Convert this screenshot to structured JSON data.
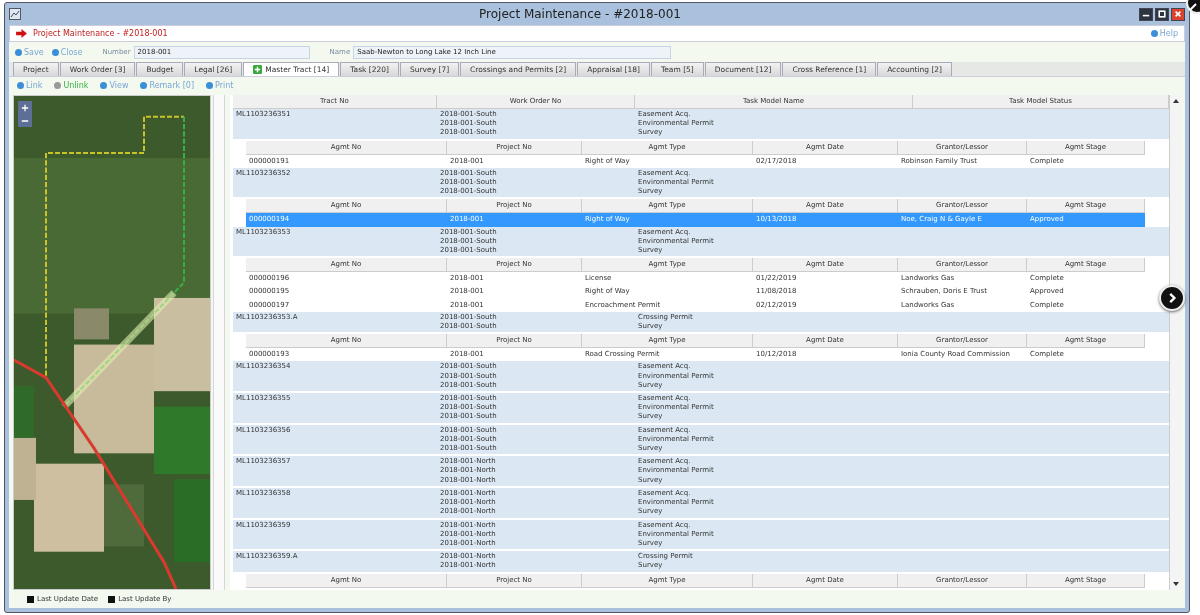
{
  "window": {
    "title": "Project Maintenance - #2018-001"
  },
  "header": {
    "title": "Project Maintenance - #2018-001",
    "help": "Help"
  },
  "toolbar": {
    "buttons": [
      "Save",
      "Close"
    ],
    "fields": [
      {
        "label": "Number",
        "value": "2018-001",
        "kind": "short"
      },
      {
        "label": "Name",
        "value": "Saab-Newton to Long Lake 12 Inch Line",
        "kind": "long"
      }
    ]
  },
  "tabs": [
    {
      "label": "Project",
      "selected": false
    },
    {
      "label": "Work Order [3]",
      "selected": false
    },
    {
      "label": "Budget",
      "selected": false
    },
    {
      "label": "Legal [26]",
      "selected": false
    },
    {
      "label": "Master Tract [14]",
      "selected": true
    },
    {
      "label": "Task [220]",
      "selected": false
    },
    {
      "label": "Survey [7]",
      "selected": false
    },
    {
      "label": "Crossings and Permits [2]",
      "selected": false
    },
    {
      "label": "Appraisal [18]",
      "selected": false
    },
    {
      "label": "Team [5]",
      "selected": false
    },
    {
      "label": "Document [12]",
      "selected": false
    },
    {
      "label": "Cross Reference [1]",
      "selected": false
    },
    {
      "label": "Accounting [2]",
      "selected": false
    }
  ],
  "actions": [
    {
      "label": "Link",
      "highlighted": false
    },
    {
      "label": "Unlink",
      "highlighted": true
    },
    {
      "label": "View",
      "highlighted": false
    },
    {
      "label": "Remark [0]",
      "highlighted": false
    },
    {
      "label": "Print",
      "highlighted": false
    }
  ],
  "table": {
    "columns": [
      "Tract No",
      "Work Order No",
      "Task Model Name",
      "Task Model Status"
    ],
    "tracts": [
      {
        "tract_no": "ML1103236351",
        "work_orders": [
          "2018-001-South",
          "2018-001-South",
          "2018-001-South"
        ],
        "task_models": [
          "Easement Acq.",
          "Environmental Permit",
          "Survey"
        ],
        "agreement_columns": [
          "Agmt No",
          "Project No",
          "Agmt Type",
          "Agmt Date",
          "Grantor/Lessor",
          "Agmt Stage"
        ],
        "agreements": [
          {
            "cells": [
              "000000191",
              "2018-001",
              "Right of Way",
              "02/17/2018",
              "Robinson Family Trust",
              "Complete"
            ],
            "selected": false
          }
        ]
      },
      {
        "tract_no": "ML1103236352",
        "work_orders": [
          "2018-001-South",
          "2018-001-South",
          "2018-001-South"
        ],
        "task_models": [
          "Easement Acq.",
          "Environmental Permit",
          "Survey"
        ],
        "agreement_columns": [
          "Agmt No",
          "Project No",
          "Agmt Type",
          "Agmt Date",
          "Grantor/Lessor",
          "Agmt Stage"
        ],
        "agreements": [
          {
            "cells": [
              "000000194",
              "2018-001",
              "Right of Way",
              "10/13/2018",
              "Noe, Craig N & Gayle E",
              "Approved"
            ],
            "selected": true
          }
        ]
      },
      {
        "tract_no": "ML1103236353",
        "work_orders": [
          "2018-001-South",
          "2018-001-South",
          "2018-001-South"
        ],
        "task_models": [
          "Easement Acq.",
          "Environmental Permit",
          "Survey"
        ],
        "agreement_columns": [
          "Agmt No",
          "Project No",
          "Agmt Type",
          "Agmt Date",
          "Grantor/Lessor",
          "Agmt Stage"
        ],
        "agreements": [
          {
            "cells": [
              "000000196",
              "2018-001",
              "License",
              "01/22/2019",
              "Landworks Gas",
              "Complete"
            ],
            "selected": false
          },
          {
            "cells": [
              "000000195",
              "2018-001",
              "Right of Way",
              "11/08/2018",
              "Schrauben, Doris E Trust",
              "Approved"
            ],
            "selected": false
          },
          {
            "cells": [
              "000000197",
              "2018-001",
              "Encroachment Permit",
              "02/12/2019",
              "Landworks Gas",
              "Complete"
            ],
            "selected": false
          }
        ]
      },
      {
        "tract_no": "ML1103236353.A",
        "work_orders": [
          "2018-001-South",
          "2018-001-South"
        ],
        "task_models": [
          "Crossing Permit",
          "Survey"
        ],
        "agreement_columns": [
          "Agmt No",
          "Project No",
          "Agmt Type",
          "Agmt Date",
          "Grantor/Lessor",
          "Agmt Stage"
        ],
        "agreements": [
          {
            "cells": [
              "000000193",
              "2018-001",
              "Road Crossing Permit",
              "10/12/2018",
              "Ionia County Road Commission",
              "Complete"
            ],
            "selected": false
          }
        ]
      },
      {
        "tract_no": "ML1103236354",
        "work_orders": [
          "2018-001-South",
          "2018-001-South",
          "2018-001-South"
        ],
        "task_models": [
          "Easement Acq.",
          "Environmental Permit",
          "Survey"
        ]
      },
      {
        "tract_no": "ML1103236355",
        "work_orders": [
          "2018-001-South",
          "2018-001-South",
          "2018-001-South"
        ],
        "task_models": [
          "Easement Acq.",
          "Environmental Permit",
          "Survey"
        ]
      },
      {
        "tract_no": "ML1103236356",
        "work_orders": [
          "2018-001-South",
          "2018-001-South",
          "2018-001-South"
        ],
        "task_models": [
          "Easement Acq.",
          "Environmental Permit",
          "Survey"
        ]
      },
      {
        "tract_no": "ML1103236357",
        "work_orders": [
          "2018-001-North",
          "2018-001-North",
          "2018-001-North"
        ],
        "task_models": [
          "Easement Acq.",
          "Environmental Permit",
          "Survey"
        ]
      },
      {
        "tract_no": "ML1103236358",
        "work_orders": [
          "2018-001-North",
          "2018-001-North",
          "2018-001-North"
        ],
        "task_models": [
          "Easement Acq.",
          "Environmental Permit",
          "Survey"
        ]
      },
      {
        "tract_no": "ML1103236359",
        "work_orders": [
          "2018-001-North",
          "2018-001-North",
          "2018-001-North"
        ],
        "task_models": [
          "Easement Acq.",
          "Environmental Permit",
          "Survey"
        ]
      },
      {
        "tract_no": "ML1103236359.A",
        "work_orders": [
          "2018-001-North",
          "2018-001-North"
        ],
        "task_models": [
          "Crossing Permit",
          "Survey"
        ],
        "agreement_columns": [
          "Agmt No",
          "Project No",
          "Agmt Type",
          "Agmt Date",
          "Grantor/Lessor",
          "Agmt Stage"
        ]
      }
    ]
  },
  "footer": {
    "legend": [
      "Last Update Date",
      "Last Update By"
    ]
  }
}
